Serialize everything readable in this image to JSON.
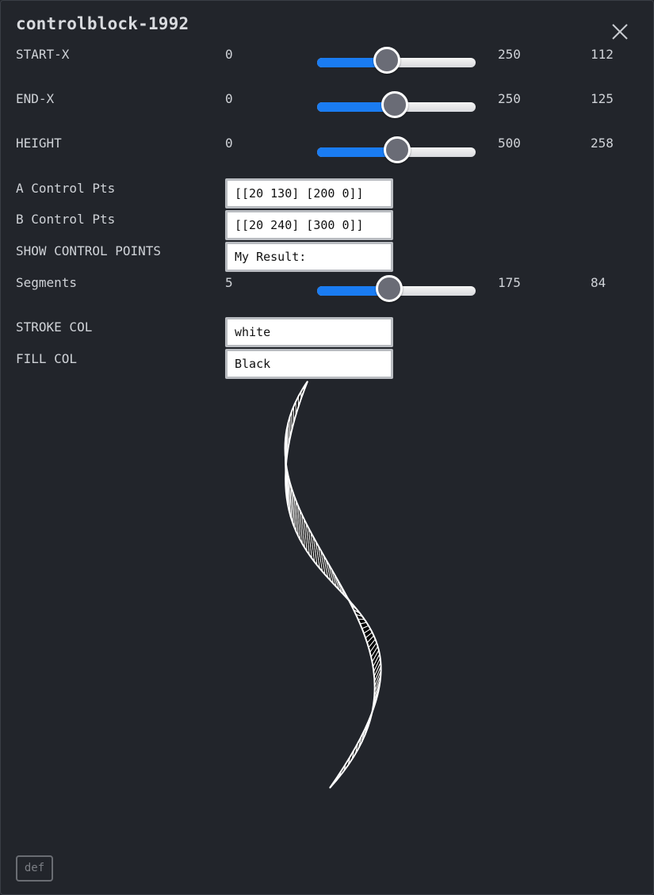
{
  "title": "controlblock-1992",
  "sliders": [
    {
      "id": "start-x",
      "label": "START-X",
      "min": "0",
      "max": "250",
      "value": "112",
      "fraction": 0.45
    },
    {
      "id": "end-x",
      "label": "END-X",
      "min": "0",
      "max": "250",
      "value": "125",
      "fraction": 0.5
    },
    {
      "id": "height",
      "label": "HEIGHT",
      "min": "0",
      "max": "500",
      "value": "258",
      "fraction": 0.516
    },
    {
      "id": "segments",
      "label": "Segments",
      "min": "5",
      "max": "175",
      "value": "84",
      "fraction": 0.465
    }
  ],
  "fields": {
    "a_control": {
      "label": "A Control Pts",
      "value": "[[20 130] [200 0]]"
    },
    "b_control": {
      "label": "B Control Pts",
      "value": "[[20 240] [300 0]]"
    },
    "show_control": {
      "label": "SHOW CONTROL POINTS",
      "value": "My Result:"
    },
    "stroke": {
      "label": "STROKE COL",
      "value": "white"
    },
    "fill": {
      "label": "FILL COL",
      "value": "Black"
    }
  },
  "footer": {
    "def_label": "def"
  },
  "colors": {
    "background": "#22252b",
    "accent": "#1a7cf2",
    "knob": "#6a6c76",
    "stroke": "#ffffff",
    "fill": "#000000"
  }
}
